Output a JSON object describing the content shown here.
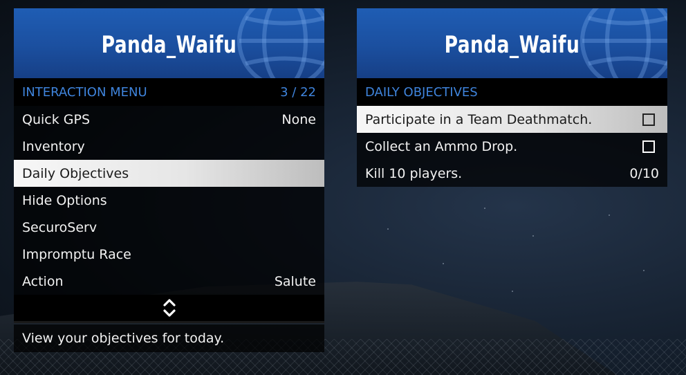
{
  "left_menu": {
    "header_title": "Panda_Waifu",
    "section_title": "INTERACTION MENU",
    "page_counter": "3 / 22",
    "items": [
      {
        "label": "Quick GPS",
        "value": "None"
      },
      {
        "label": "Inventory",
        "value": ""
      },
      {
        "label": "Daily Objectives",
        "value": ""
      },
      {
        "label": "Hide Options",
        "value": ""
      },
      {
        "label": "SecuroServ",
        "value": ""
      },
      {
        "label": "Impromptu Race",
        "value": ""
      },
      {
        "label": "Action",
        "value": "Salute"
      }
    ],
    "selected_index": 2,
    "description": "View your objectives for today."
  },
  "right_menu": {
    "header_title": "Panda_Waifu",
    "section_title": "DAILY OBJECTIVES",
    "objectives": [
      {
        "label": "Participate in a Team Deathmatch.",
        "status": "checkbox-unchecked"
      },
      {
        "label": "Collect an Ammo Drop.",
        "status": "checkbox-unchecked"
      },
      {
        "label": "Kill 10 players.",
        "progress": "0/10"
      }
    ],
    "selected_index": 0
  },
  "colors": {
    "header_blue": "#1f5db4",
    "section_text_blue": "#3f84dc",
    "selected_row": "#e6e6e6",
    "row_background": "#000000"
  },
  "icons": {
    "header_decoration": "globe-icon",
    "scroll_indicator": "up-down-chevron-icon",
    "objective_box": "checkbox-icon"
  }
}
